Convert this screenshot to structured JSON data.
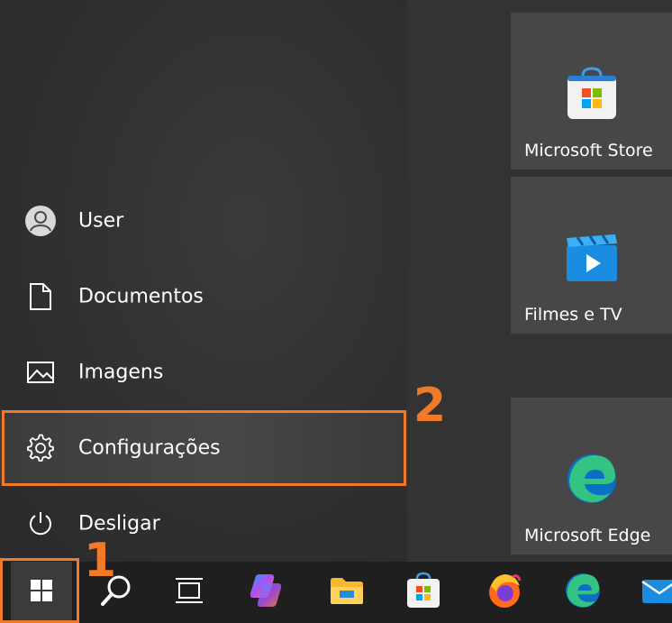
{
  "menu": {
    "items": [
      {
        "label": "User",
        "icon": "user-avatar-icon"
      },
      {
        "label": "Documentos",
        "icon": "document-icon"
      },
      {
        "label": "Imagens",
        "icon": "pictures-icon"
      },
      {
        "label": "Configurações",
        "icon": "settings-gear-icon"
      },
      {
        "label": "Desligar",
        "icon": "power-icon"
      }
    ]
  },
  "tiles": [
    {
      "label": "Microsoft Store",
      "icon": "microsoft-store-icon"
    },
    {
      "label": "Filmes e TV",
      "icon": "movies-tv-icon"
    },
    {
      "label": "Microsoft Edge",
      "icon": "edge-icon"
    }
  ],
  "annotations": {
    "step1": "1",
    "step2": "2",
    "accent_color": "#f07a2a"
  },
  "taskbar": {
    "items": [
      "windows-start-icon",
      "search-icon",
      "task-view-icon",
      "copilot-icon",
      "file-explorer-icon",
      "microsoft-store-icon",
      "firefox-icon",
      "edge-icon",
      "mail-icon"
    ]
  }
}
